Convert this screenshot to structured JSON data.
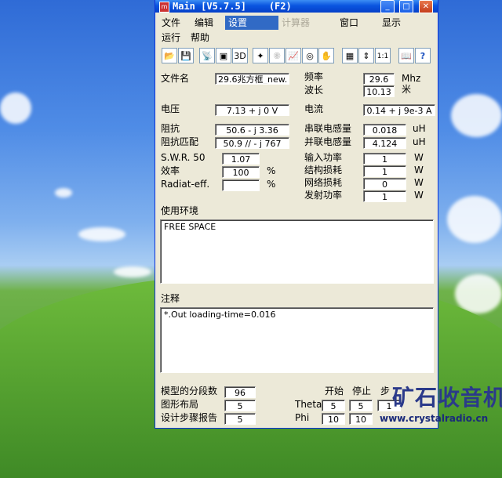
{
  "window": {
    "title": "Main [V5.7.5]    (F2)",
    "controls": {
      "minimize": "_",
      "maximize": "□",
      "close": "✕"
    }
  },
  "menu": {
    "items": [
      "文件",
      "编辑",
      "设置",
      "计算器",
      "窗口",
      "显示",
      "运行",
      "帮助"
    ],
    "active": "设置",
    "disabled": "计算器"
  },
  "toolbar": {
    "icons": [
      "open-folder-icon",
      "save-icon",
      "antenna-icon",
      "cube-icon",
      "3d-view-icon",
      "magic-icon",
      "disabled-tool-icon",
      "graph-icon",
      "target-icon",
      "hand-icon",
      "calculator-icon",
      "adjust-icon",
      "one-to-one-icon",
      "book-icon",
      "help-icon"
    ],
    "glyphs": [
      "📂",
      "💾",
      "📡",
      "▣",
      "3D",
      "✦",
      "⑧",
      "📈",
      "◎",
      "✋",
      "▦",
      "⇕",
      "1:1",
      "📖",
      "?"
    ]
  },
  "form": {
    "filename_label": "文件名",
    "filename_value": "29.6兆方框_new.",
    "frequency_label": "频率",
    "frequency_value": "29.6",
    "frequency_unit": "Mhz",
    "wavelength_label": "波长",
    "wavelength_value": "10.13",
    "wavelength_unit": "米",
    "voltage_label": "电压",
    "voltage_value": "7.13 + j 0 V",
    "current_label": "电流",
    "current_value": "0.14 + j 9e-3 A",
    "impedance_label": "阻抗",
    "impedance_value": "50.6 - j 3.36",
    "match_label": "阻抗匹配",
    "match_value": "50.9 // - j 767",
    "series_l_label": "串联电感量",
    "series_l_value": "0.018",
    "series_l_unit": "uH",
    "parallel_l_label": "并联电感量",
    "parallel_l_value": "4.124",
    "parallel_l_unit": "uH",
    "swr_label": "S.W.R. 50",
    "swr_value": "1.07",
    "efficiency_label": "效率",
    "efficiency_value": "100",
    "efficiency_unit": "%",
    "radiat_label": "Radiat-eff.",
    "radiat_value": "",
    "radiat_unit": "%",
    "input_power_label": "输入功率",
    "input_power_value": "1",
    "input_power_unit": "W",
    "struct_loss_label": "结构损耗",
    "struct_loss_value": "1",
    "struct_loss_unit": "W",
    "network_loss_label": "网络损耗",
    "network_loss_value": "0",
    "network_loss_unit": "W",
    "radiated_power_label": "发射功率",
    "radiated_power_value": "1",
    "radiated_power_unit": "W"
  },
  "environment": {
    "label": "使用环境",
    "value": "FREE SPACE"
  },
  "notes": {
    "label": "注释",
    "value": "*.Out loading-time=0.016"
  },
  "bottom": {
    "segments_label": "模型的分段数",
    "segments_value": "96",
    "layout_label": "图形布局",
    "layout_value": "5",
    "steps_label": "设计步骤报告",
    "steps_value": "5",
    "start_label": "开始",
    "stop_label": "停止",
    "step_label": "步",
    "theta_label": "Theta",
    "theta_start": "5",
    "theta_stop": "5",
    "theta_step": "1",
    "phi_label": "Phi",
    "phi_start": "10",
    "phi_stop": "10"
  },
  "watermark": {
    "title": "矿石收音机",
    "url": "www.crystalradio.cn"
  }
}
